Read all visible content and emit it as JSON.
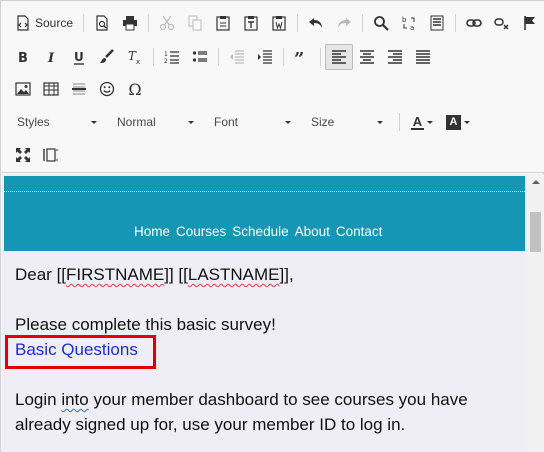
{
  "toolbar": {
    "source_label": "Source",
    "styles_label": "Styles",
    "format_label": "Normal",
    "font_label": "Font",
    "size_label": "Size",
    "text_color_label": "A",
    "bg_color_label": "A",
    "special_char_label": "Ω"
  },
  "content": {
    "nav_items": [
      "Home",
      "Courses",
      "Schedule",
      "About",
      "Contact"
    ],
    "greeting_prefix": "Dear [[",
    "firstname_token": "FIRSTNAME",
    "greeting_mid": "]] [[",
    "lastname_token": "LASTNAME",
    "greeting_suffix": "]],",
    "survey_line": "Please complete this basic survey!",
    "survey_link": "Basic Questions",
    "login_prefix": "Login ",
    "login_into": "into",
    "login_suffix": " your member dashboard to see courses you have already signed up for, use your member ID to log in."
  },
  "colors": {
    "banner": "#1596b4",
    "link": "#1a2fd3",
    "highlight_box": "#e30000",
    "content_bg": "#efedf5"
  }
}
